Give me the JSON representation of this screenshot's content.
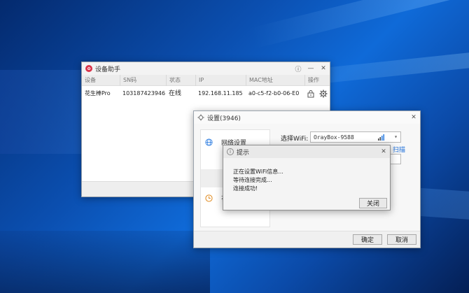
{
  "main_window": {
    "title": "设备助手",
    "columns": [
      "设备",
      "SN码",
      "状态",
      "IP",
      "MAC地址",
      "操作"
    ],
    "device": {
      "name": "花生棒Pro",
      "sn": "103187423946",
      "status": "在线",
      "ip": "192.168.11.185",
      "mac": "a0-c5-f2-b0-06-E0"
    }
  },
  "settings_window": {
    "title": "设置(3946)",
    "side_items": [
      "网络设置",
      "花"
    ],
    "wifi_label": "选择WiFi:",
    "wifi_value": "OrayBox-9588",
    "scan_link": "扫描",
    "ok_label": "确定",
    "cancel_label": "取消"
  },
  "tip_dialog": {
    "title": "提示",
    "messages": [
      "正在设置WiFi信息...",
      "等待连接完成...",
      "连接成功!"
    ],
    "close_label": "关闭"
  },
  "colors": {
    "accent_link": "#1e6fd9",
    "logo": "#d9334a",
    "desktop": "#0b4fb0"
  }
}
